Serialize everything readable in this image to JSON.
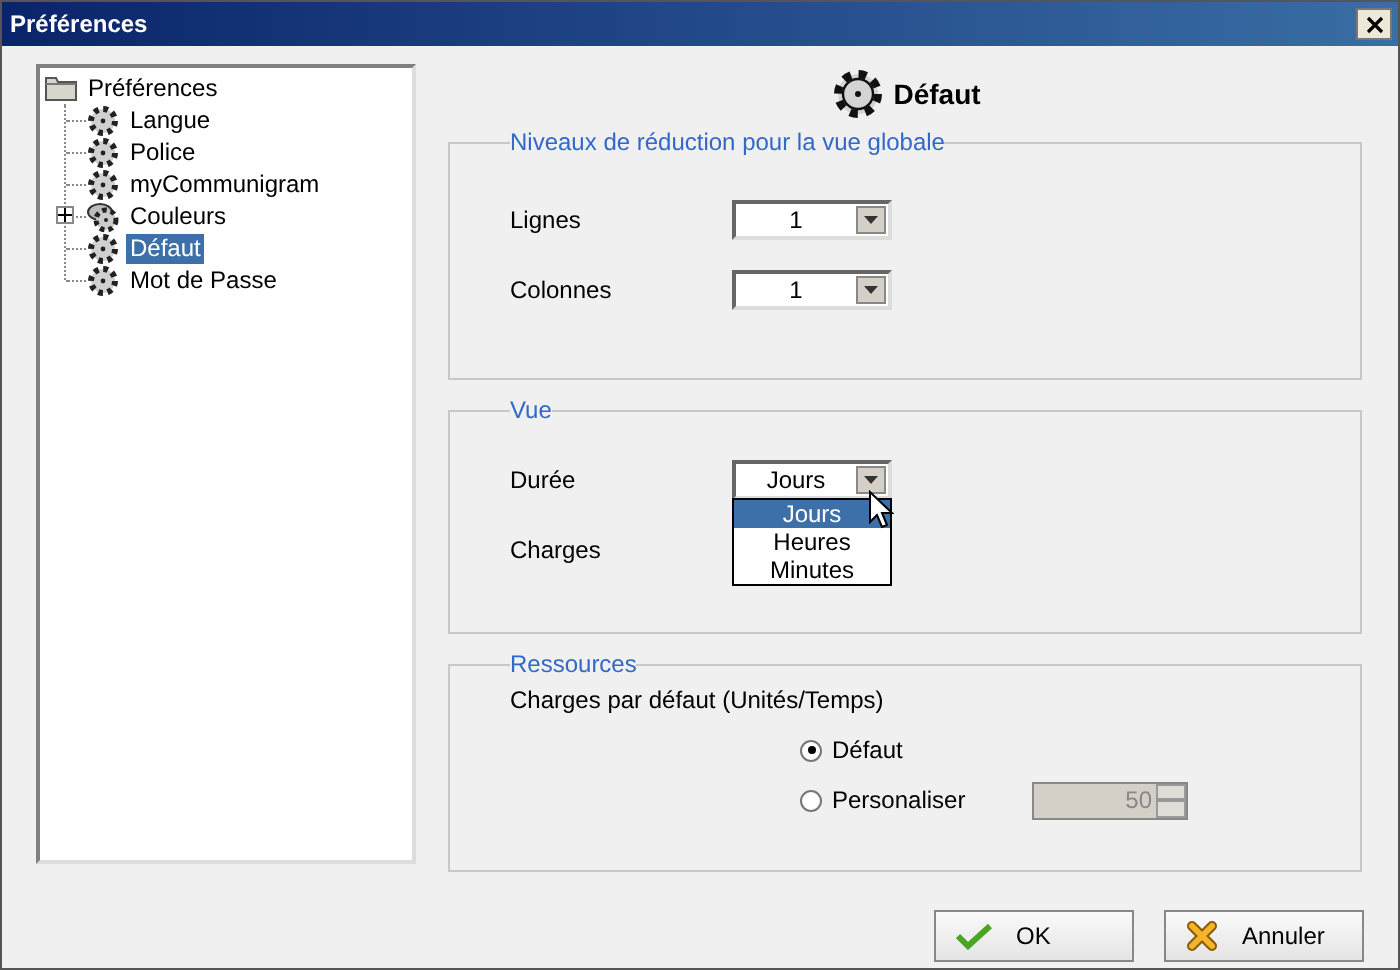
{
  "window": {
    "title": "Préférences"
  },
  "tree": {
    "label": "Préférences",
    "children": [
      {
        "label": "Langue",
        "kind": "leaf",
        "selected": false
      },
      {
        "label": "Police",
        "kind": "leaf",
        "selected": false
      },
      {
        "label": "myCommunigram",
        "kind": "leaf",
        "selected": false
      },
      {
        "label": "Couleurs",
        "kind": "group",
        "expanded": false,
        "selected": false
      },
      {
        "label": "Défaut",
        "kind": "leaf",
        "selected": true
      },
      {
        "label": "Mot de Passe",
        "kind": "leaf",
        "selected": false
      }
    ]
  },
  "page": {
    "title": "Défaut"
  },
  "groups": [
    {
      "title": "Niveaux de réduction pour la vue globale",
      "kind": "combos",
      "rows": [
        {
          "label": "Lignes",
          "value": "1"
        },
        {
          "label": "Colonnes",
          "value": "1"
        }
      ]
    },
    {
      "title": "Vue",
      "kind": "combos",
      "rows": [
        {
          "label": "Durée",
          "value": "Jours",
          "open": true,
          "options": [
            {
              "label": "Jours",
              "selected": true
            },
            {
              "label": "Heures",
              "selected": false
            },
            {
              "label": "Minutes",
              "selected": false
            }
          ]
        },
        {
          "label": "Charges"
        }
      ]
    },
    {
      "title": "Ressources",
      "kind": "radios",
      "description": "Charges par défaut (Unités/Temps)",
      "options": [
        {
          "label": "Défaut",
          "selected": true
        },
        {
          "label": "Personaliser",
          "selected": false,
          "spin": {
            "value": "50",
            "disabled": true
          }
        }
      ]
    }
  ],
  "buttons": [
    {
      "label": "OK",
      "kind": "ok"
    },
    {
      "label": "Annuler",
      "kind": "cancel"
    }
  ]
}
